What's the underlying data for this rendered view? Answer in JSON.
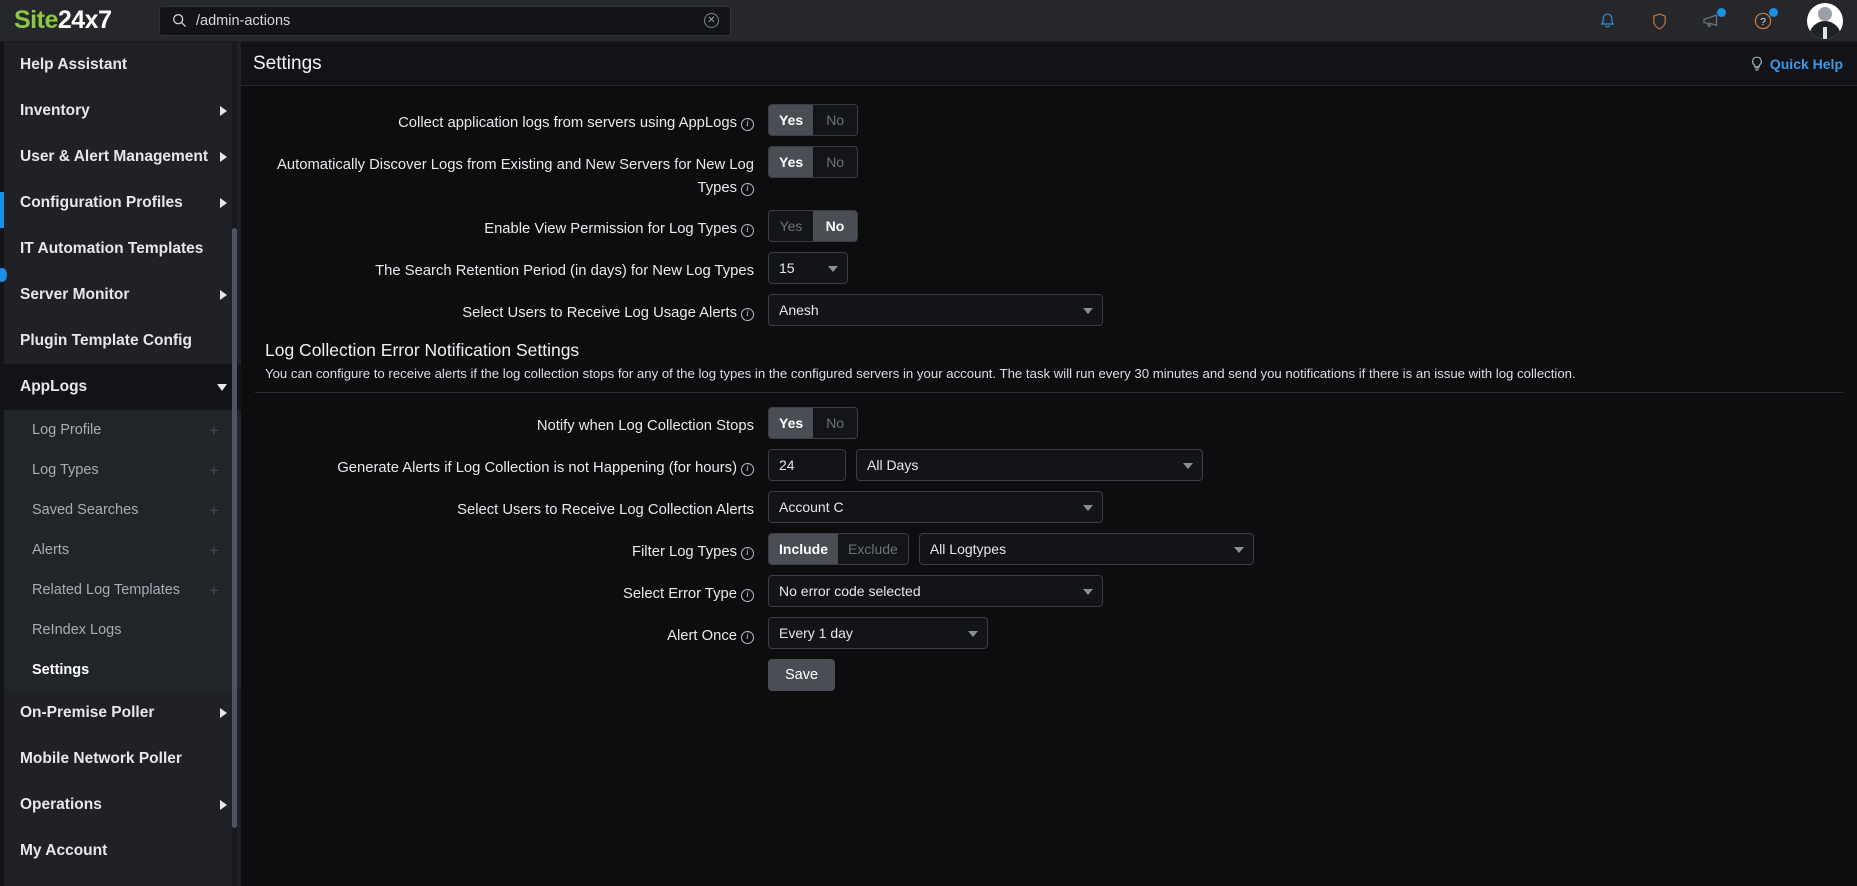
{
  "topbar": {
    "brand_site": "Site",
    "brand_num": "24x7",
    "search_value": "/admin-actions",
    "search_placeholder": "Search",
    "icons": {
      "search": "search-icon",
      "clear": "clear-icon",
      "bell": "notification-bell-icon",
      "shield": "shield-icon",
      "announce": "announcement-megaphone-icon",
      "help": "help-question-icon",
      "avatar": "user-avatar"
    }
  },
  "sidebar": {
    "items": [
      {
        "label": "Help Assistant",
        "type": "item",
        "arrow": "none"
      },
      {
        "label": "Inventory",
        "type": "item",
        "arrow": "right"
      },
      {
        "label": "User & Alert Management",
        "type": "item",
        "arrow": "right"
      },
      {
        "label": "Configuration Profiles",
        "type": "item",
        "arrow": "right"
      },
      {
        "label": "IT Automation Templates",
        "type": "item",
        "arrow": "none"
      },
      {
        "label": "Server Monitor",
        "type": "item",
        "arrow": "right"
      },
      {
        "label": "Plugin Template Config",
        "type": "item",
        "arrow": "none"
      },
      {
        "label": "AppLogs",
        "type": "item",
        "arrow": "down",
        "expanded": true
      }
    ],
    "sub_items": [
      {
        "label": "Log Profile",
        "plus": "+",
        "active": false
      },
      {
        "label": "Log Types",
        "plus": "+",
        "active": false
      },
      {
        "label": "Saved Searches",
        "plus": "+",
        "active": false
      },
      {
        "label": "Alerts",
        "plus": "+",
        "active": false
      },
      {
        "label": "Related Log Templates",
        "plus": "+",
        "active": false
      },
      {
        "label": "ReIndex Logs",
        "plus": "",
        "active": false
      },
      {
        "label": "Settings",
        "plus": "",
        "active": true
      }
    ],
    "items_bottom": [
      {
        "label": "On-Premise Poller",
        "arrow": "right"
      },
      {
        "label": "Mobile Network Poller",
        "arrow": "none"
      },
      {
        "label": "Operations",
        "arrow": "right"
      },
      {
        "label": "My Account",
        "arrow": "none"
      }
    ]
  },
  "page": {
    "title": "Settings",
    "quick_help": "Quick Help"
  },
  "form": {
    "rows": [
      {
        "label": "Collect application logs from servers using AppLogs",
        "info": true,
        "control": "toggle",
        "options": [
          "Yes",
          "No"
        ],
        "selected": "Yes"
      },
      {
        "label": "Automatically Discover Logs from Existing and New Servers for New Log Types",
        "info": true,
        "control": "toggle",
        "options": [
          "Yes",
          "No"
        ],
        "selected": "Yes"
      },
      {
        "label": "Enable View Permission for Log Types",
        "info": true,
        "control": "toggle",
        "options": [
          "Yes",
          "No"
        ],
        "selected": "No"
      },
      {
        "label": "The Search Retention Period (in days) for New Log Types",
        "info": false,
        "control": "select",
        "value": "15"
      },
      {
        "label": "Select Users to Receive Log Usage Alerts",
        "info": true,
        "control": "select",
        "value": "Anesh"
      }
    ]
  },
  "section": {
    "title": "Log Collection Error Notification Settings",
    "description": "You can configure to receive alerts if the log collection stops for any of the log types in the configured servers in your account. The task will run every 30 minutes and send you notifications if there is an issue with log collection."
  },
  "form2": {
    "notify": {
      "label": "Notify when Log Collection Stops",
      "info": false,
      "options": [
        "Yes",
        "No"
      ],
      "selected": "Yes"
    },
    "generate_alerts": {
      "label": "Generate Alerts if Log Collection is not Happening (for hours)",
      "info": true,
      "hours": "24",
      "days_value": "All Days"
    },
    "users": {
      "label": "Select Users to Receive Log Collection Alerts",
      "info": false,
      "value": "Account C"
    },
    "filter_log_types": {
      "label": "Filter Log Types",
      "info": true,
      "options": [
        "Include",
        "Exclude"
      ],
      "selected": "Include",
      "value": "All Logtypes"
    },
    "error_type": {
      "label": "Select Error Type",
      "info": true,
      "value": "No error code selected"
    },
    "alert_once": {
      "label": "Alert Once",
      "info": true,
      "value": "Every 1 day"
    },
    "save_label": "Save"
  },
  "colors": {
    "brand_green": "#8dc63f",
    "accent_blue": "#1a8fe3",
    "link_blue": "#3d9ae8",
    "toggle_on": "#4a4d54",
    "sidebar_bg": "#1f2126",
    "topbar_bg": "#25272b",
    "page_bg": "#0d0d10"
  }
}
